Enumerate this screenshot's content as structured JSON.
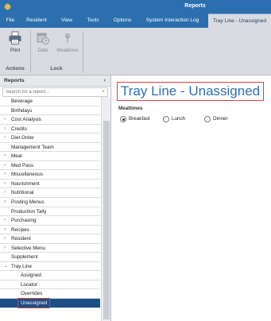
{
  "window": {
    "title": "Reports"
  },
  "menu": {
    "tabs": [
      {
        "label": "File"
      },
      {
        "label": "Resident"
      },
      {
        "label": "View"
      },
      {
        "label": "Tools"
      },
      {
        "label": "Options"
      },
      {
        "label": "System Interaction Log"
      },
      {
        "label": "Tray Line - Unassigned"
      }
    ]
  },
  "ribbon": {
    "print_label": "Print",
    "date_label": "Date",
    "mealtimes_label": "Mealtimes",
    "groups": {
      "actions": "Actions",
      "lock": "Lock"
    }
  },
  "left_panel": {
    "header": "Reports",
    "collapse_glyph": "‹",
    "search_placeholder": "Search for a report...",
    "clear_glyph": "×",
    "items": [
      {
        "label": "Beverage",
        "expandable": false
      },
      {
        "label": "Birthdays",
        "expandable": false
      },
      {
        "label": "Cost Analysis",
        "expandable": true
      },
      {
        "label": "Credits",
        "expandable": true
      },
      {
        "label": "Diet Order",
        "expandable": true
      },
      {
        "label": "Management Team",
        "expandable": false
      },
      {
        "label": "Meal",
        "expandable": true
      },
      {
        "label": "Med Pass",
        "expandable": true
      },
      {
        "label": "Miscellaneous",
        "expandable": true
      },
      {
        "label": "Nourishment",
        "expandable": true
      },
      {
        "label": "Nutritional",
        "expandable": true
      },
      {
        "label": "Posting Menus",
        "expandable": true
      },
      {
        "label": "Production Tally",
        "expandable": false
      },
      {
        "label": "Purchasing",
        "expandable": true
      },
      {
        "label": "Recipes",
        "expandable": true
      },
      {
        "label": "Resident",
        "expandable": true
      },
      {
        "label": "Selective Menu",
        "expandable": true
      },
      {
        "label": "Supplement",
        "expandable": false
      },
      {
        "label": "Tray Line",
        "expandable": true,
        "expanded": true
      },
      {
        "label": "Assigned",
        "child": true
      },
      {
        "label": "Locator",
        "child": true
      },
      {
        "label": "Overrides",
        "child": true
      },
      {
        "label": "Unassigned",
        "child": true,
        "selected": true
      }
    ]
  },
  "main": {
    "title": "Tray Line - Unassigned",
    "mealtimes_label": "Mealtimes",
    "options": [
      {
        "label": "Breakfast",
        "checked": true
      },
      {
        "label": "Lunch",
        "checked": false
      },
      {
        "label": "Dinner",
        "checked": false
      }
    ]
  },
  "colors": {
    "accent": "#2b6fae",
    "highlight": "#d9443a",
    "selected_row": "#1d4e86"
  }
}
